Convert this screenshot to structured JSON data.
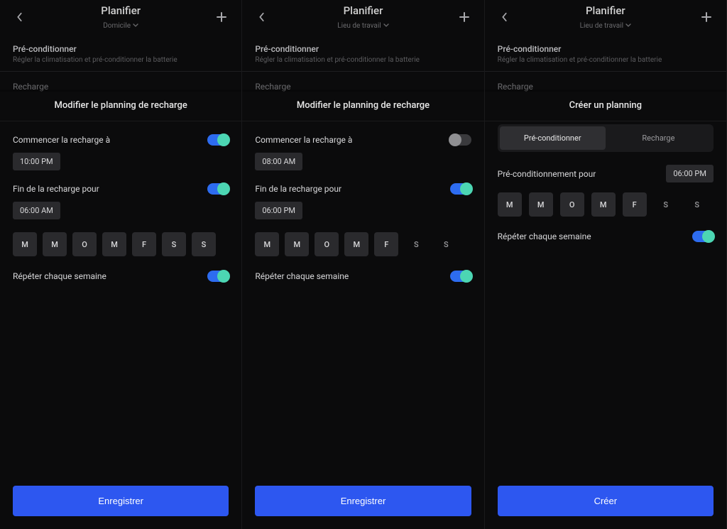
{
  "common": {
    "title": "Planifier",
    "precond_title": "Pré-conditionner",
    "precond_sub": "Régler la climatisation et pré-conditionner la batterie",
    "recharge_title": "Recharge",
    "repeat_label": "Répéter chaque semaine",
    "days": [
      "M",
      "M",
      "O",
      "M",
      "F",
      "S",
      "S"
    ]
  },
  "pane1": {
    "subtitle": "Domicile",
    "overlay_title": "Modifier le planning de recharge",
    "start_label": "Commencer la recharge à",
    "start_time": "10:00 PM",
    "end_label": "Fin de la recharge pour",
    "end_time": "06:00 AM",
    "save": "Enregistrer"
  },
  "pane2": {
    "subtitle": "Lieu de travail",
    "overlay_title": "Modifier le planning de recharge",
    "start_label": "Commencer la recharge à",
    "start_time": "08:00 AM",
    "end_label": "Fin de la recharge pour",
    "end_time": "06:00 PM",
    "save": "Enregistrer"
  },
  "pane3": {
    "subtitle": "Lieu de travail",
    "overlay_title": "Créer un planning",
    "tab1": "Pré-conditionner",
    "tab2": "Recharge",
    "precond_for": "Pré-conditionnement pour",
    "precond_time": "06:00 PM",
    "create": "Créer"
  }
}
